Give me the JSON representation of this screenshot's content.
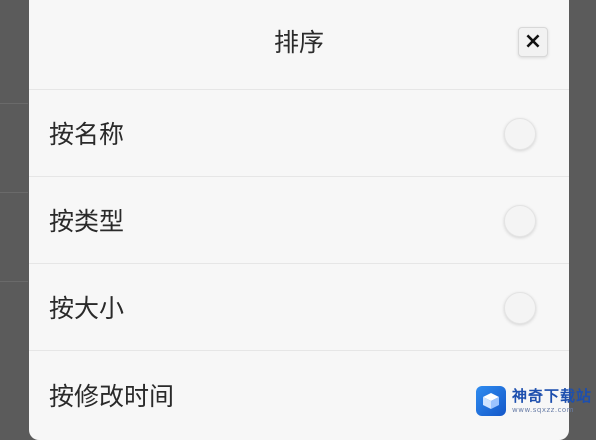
{
  "dialog": {
    "title": "排序",
    "close_label": "×",
    "options": [
      {
        "label": "按名称",
        "selected": false
      },
      {
        "label": "按类型",
        "selected": false
      },
      {
        "label": "按大小",
        "selected": false
      },
      {
        "label": "按修改时间",
        "selected": false
      }
    ]
  },
  "watermark": {
    "title": "神奇下载站",
    "subtitle": "www.sqxzz.com"
  }
}
